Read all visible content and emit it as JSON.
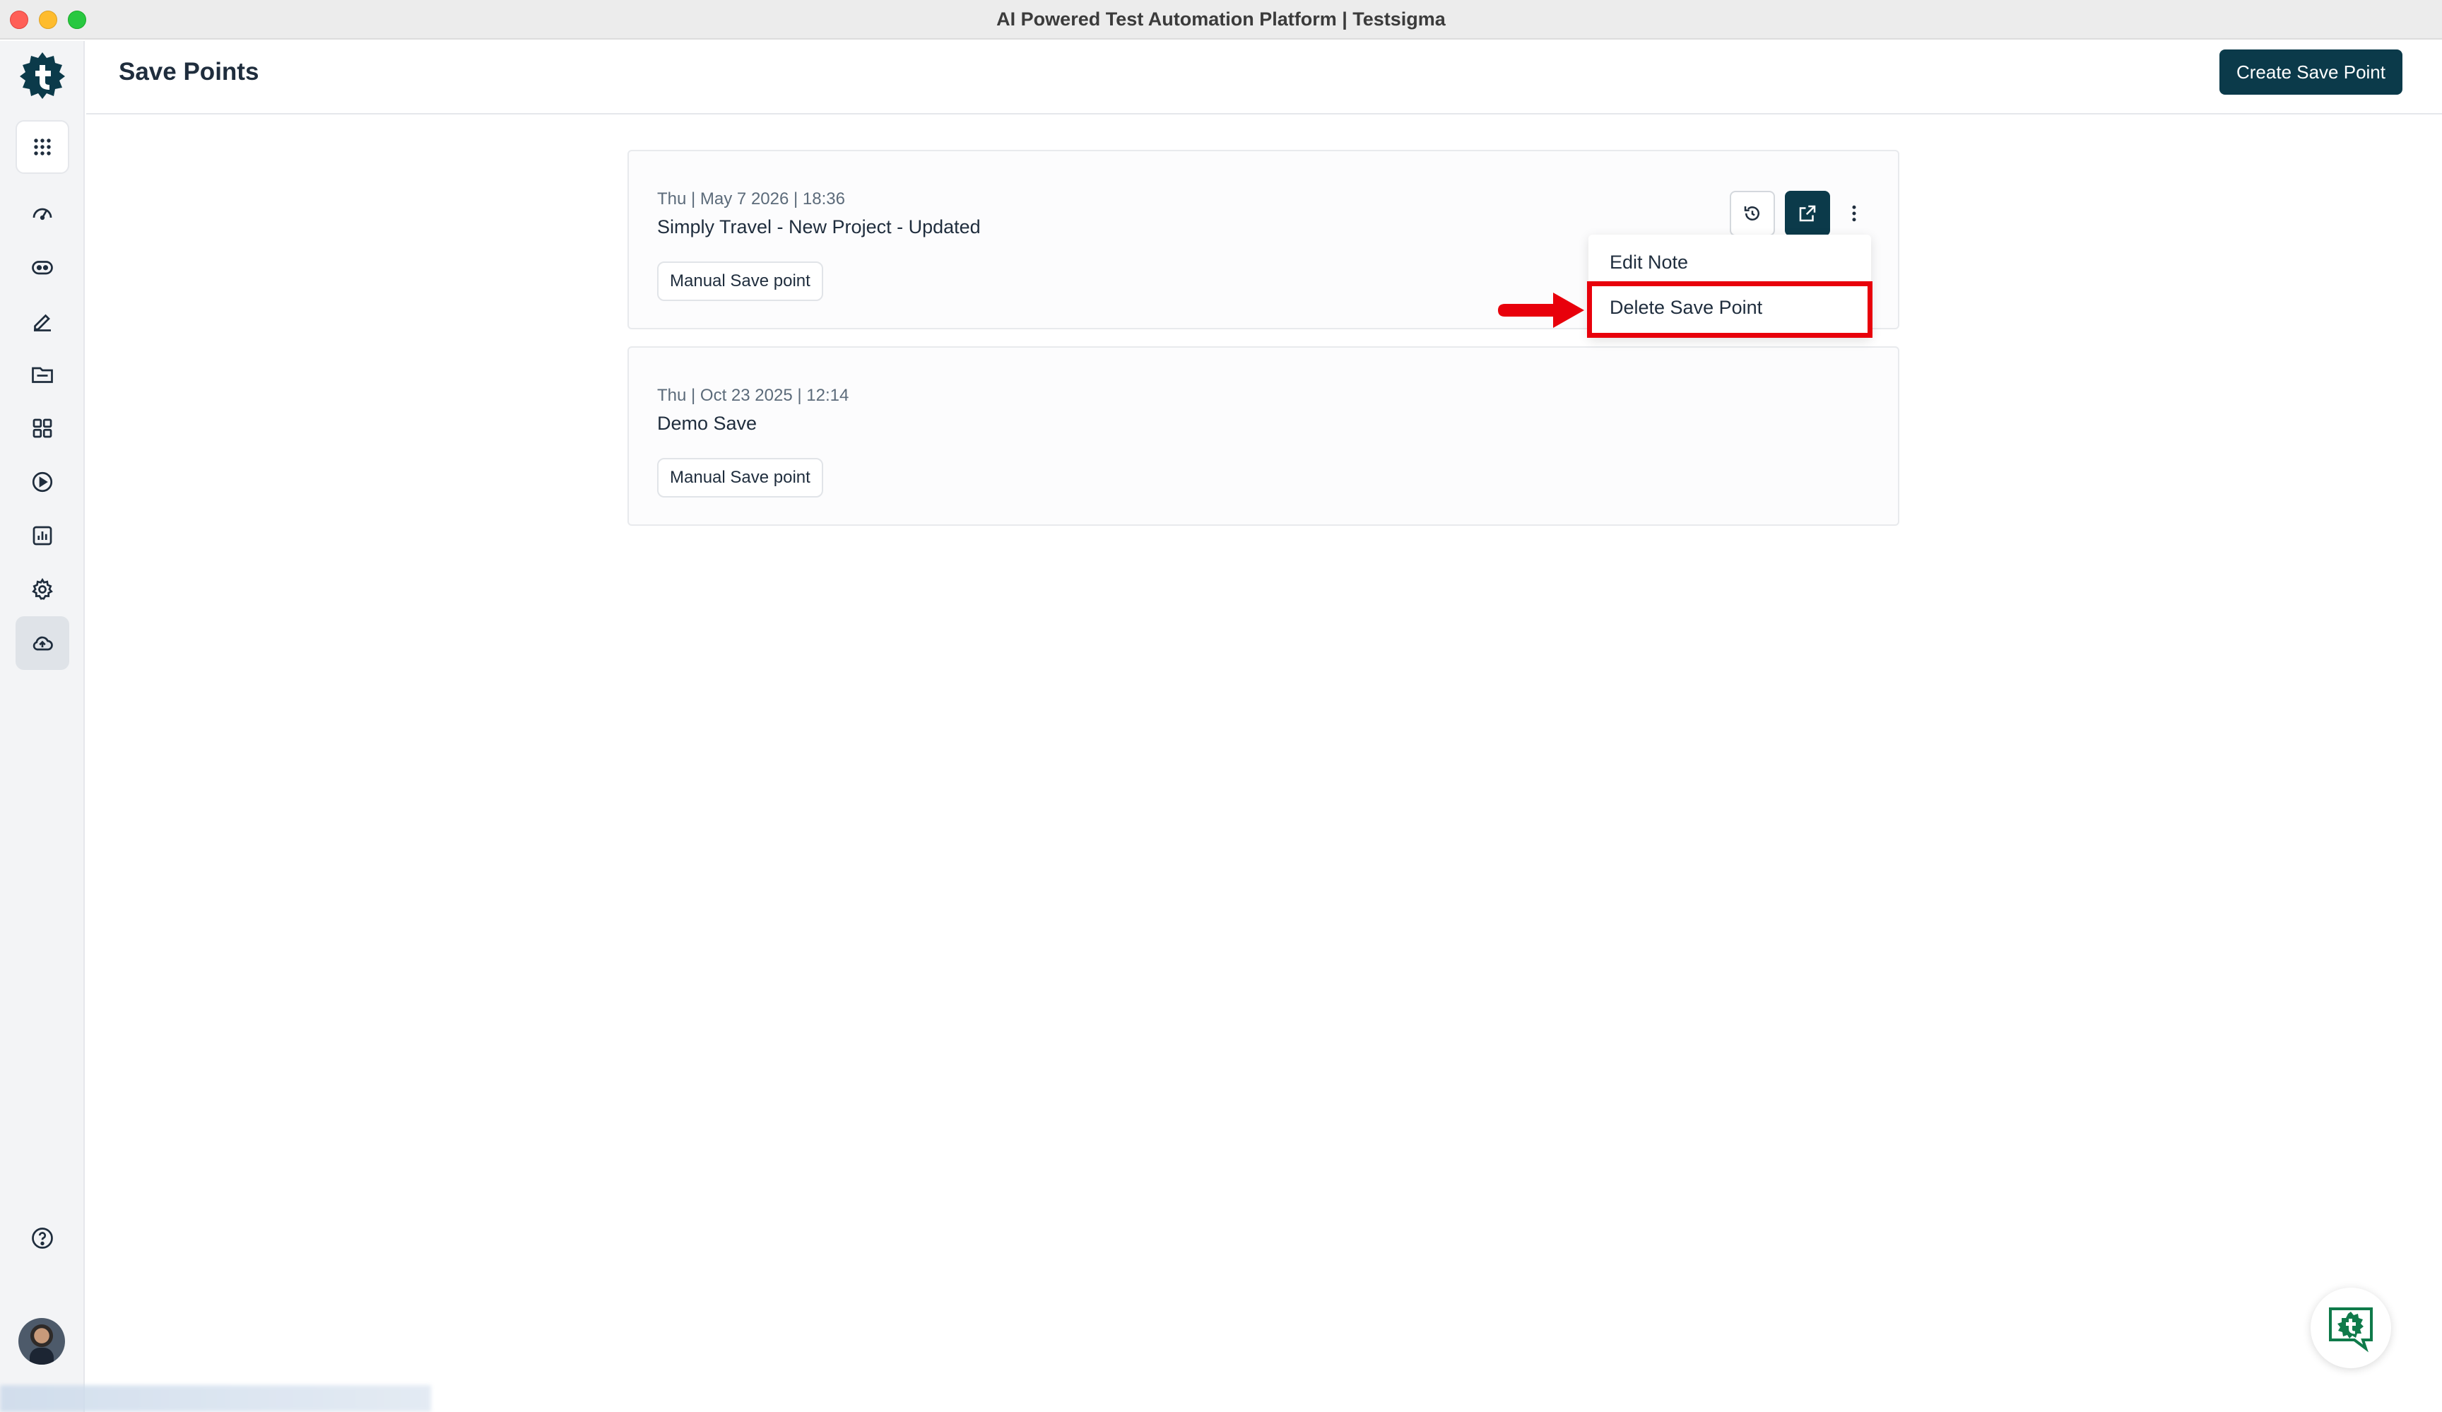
{
  "window": {
    "title": "AI Powered Test Automation Platform | Testsigma"
  },
  "sidebar": {
    "logo_icon": "testsigma-logo-icon",
    "items": [
      {
        "name": "apps-grid-icon"
      },
      {
        "name": "dashboard-icon"
      },
      {
        "name": "atto-agent-icon"
      },
      {
        "name": "test-authoring-icon"
      },
      {
        "name": "test-data-icon"
      },
      {
        "name": "elements-icon"
      },
      {
        "name": "run-icon"
      },
      {
        "name": "reports-icon"
      },
      {
        "name": "settings-icon"
      },
      {
        "name": "cloud-save-icon",
        "active": true
      }
    ],
    "help_icon": "help-icon",
    "avatar_icon": "user-avatar"
  },
  "header": {
    "title": "Save Points",
    "create_button": "Create Save Point"
  },
  "save_points": [
    {
      "date": "Thu | May 7 2026 | 18:36",
      "name": "Simply Travel - New Project - Updated",
      "tag": "Manual Save point"
    },
    {
      "date": "Thu | Oct 23 2025 | 12:14",
      "name": "Demo Save",
      "tag": "Manual Save point"
    }
  ],
  "context_menu": {
    "items": [
      "Edit Note",
      "Delete Save Point"
    ],
    "highlighted": "Delete Save Point"
  },
  "colors": {
    "primary": "#0b3a4a",
    "highlight": "#e8000b",
    "sidebar_bg": "#f3f4f6"
  }
}
